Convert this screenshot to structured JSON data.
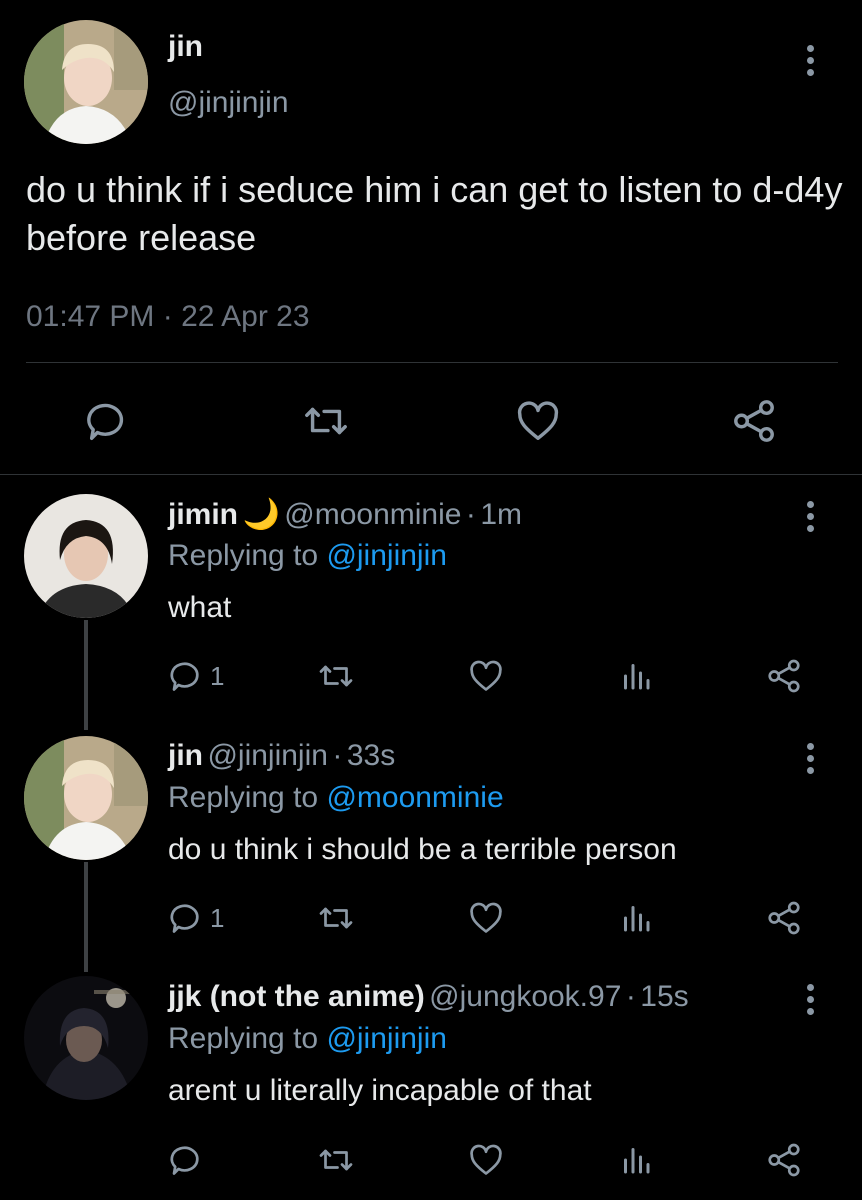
{
  "main_tweet": {
    "name": "jin",
    "handle": "@jinjinjin",
    "text": "do u think if i seduce him i can get to listen to d-d4y before release",
    "time": "01:47 PM",
    "separator": "·",
    "date": "22 Apr 23",
    "actions": [
      "reply-icon",
      "retweet-icon",
      "like-icon",
      "share-icon"
    ]
  },
  "replies": [
    {
      "name": "jimin",
      "emoji": "🌙",
      "handle": "@moonminie",
      "dot": "·",
      "time": "1m",
      "replying_prefix": "Replying to",
      "replying_to": "@jinjinjin",
      "text": "what",
      "reply_count": "1"
    },
    {
      "name": "jin",
      "handle": "@jinjinjin",
      "dot": "·",
      "time": "33s",
      "replying_prefix": "Replying to",
      "replying_to": "@moonminie",
      "text": "do u think i should be a terrible person",
      "reply_count": "1"
    },
    {
      "name": "jjk (not the anime)",
      "handle": "@jungkook.97",
      "dot": "·",
      "time": "15s",
      "replying_prefix": "Replying to",
      "replying_to": "@jinjinjin",
      "text": "arent u literally incapable of that",
      "reply_count": ""
    }
  ],
  "colors": {
    "background": "#000000",
    "text": "#e7e9ea",
    "muted": "#8b98a5",
    "link": "#1d9bf0",
    "divider": "#2f3336"
  }
}
